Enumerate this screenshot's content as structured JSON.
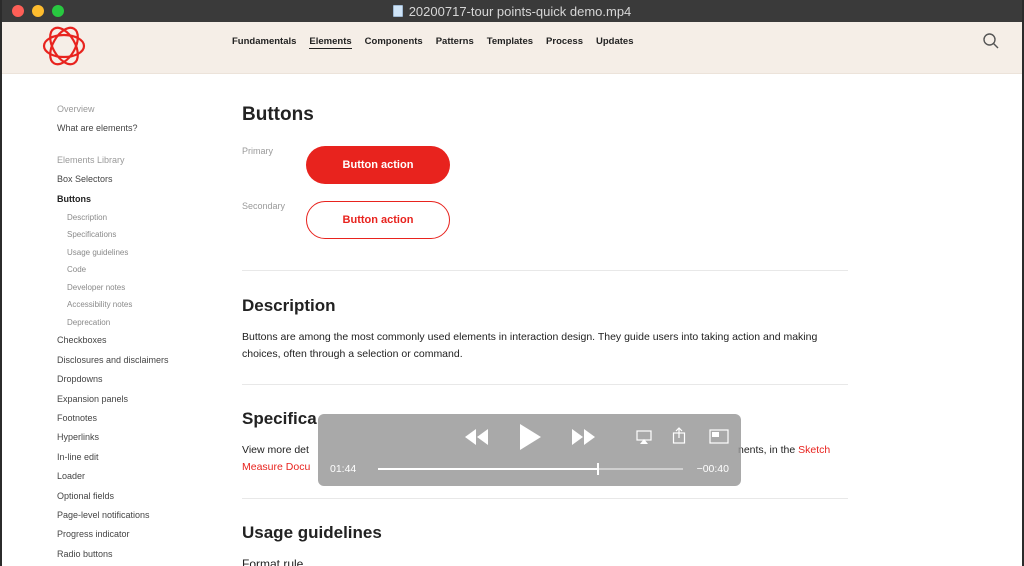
{
  "window": {
    "title": "20200717-tour points-quick demo.mp4"
  },
  "nav": {
    "links": [
      "Fundamentals",
      "Elements",
      "Components",
      "Patterns",
      "Templates",
      "Process",
      "Updates"
    ],
    "active": "Elements"
  },
  "sidebar": {
    "overview": "Overview",
    "what_are_elements": "What are elements?",
    "library_heading": "Elements Library",
    "box_selectors": "Box Selectors",
    "buttons": "Buttons",
    "sub": [
      "Description",
      "Specifications",
      "Usage guidelines",
      "Code",
      "Developer notes",
      "Accessibility notes",
      "Deprecation"
    ],
    "items": [
      "Checkboxes",
      "Disclosures and disclaimers",
      "Dropdowns",
      "Expansion panels",
      "Footnotes",
      "Hyperlinks",
      "In-line edit",
      "Loader",
      "Optional fields",
      "Page-level notifications",
      "Progress indicator",
      "Radio buttons"
    ]
  },
  "main": {
    "title": "Buttons",
    "primary_label": "Primary",
    "primary_button": "Button action",
    "secondary_label": "Secondary",
    "secondary_button": "Button action",
    "description_heading": "Description",
    "description_text": "Buttons are among the most commonly used elements in interaction design. They guide users into taking action and making choices, often through a selection or command.",
    "spec_heading_visible": "Specifica",
    "spec_text_start": "View more det",
    "spec_text_end": "nents, in the ",
    "spec_link_1": "Sketch",
    "spec_link_2": "Measure Docu",
    "usage_heading": "Usage guidelines",
    "usage_sub": "Format rule"
  },
  "player": {
    "elapsed": "01:44",
    "remaining": "−00:40",
    "progress": 0.72
  },
  "colors": {
    "accent": "#e8231e",
    "nav_bg": "#f5eee7"
  },
  "icons": {
    "search": "search-icon",
    "rewind": "rewind-icon",
    "play": "play-icon",
    "forward": "fast-forward-icon",
    "airplay": "airplay-icon",
    "share": "share-icon",
    "pip": "picture-in-picture-icon"
  }
}
